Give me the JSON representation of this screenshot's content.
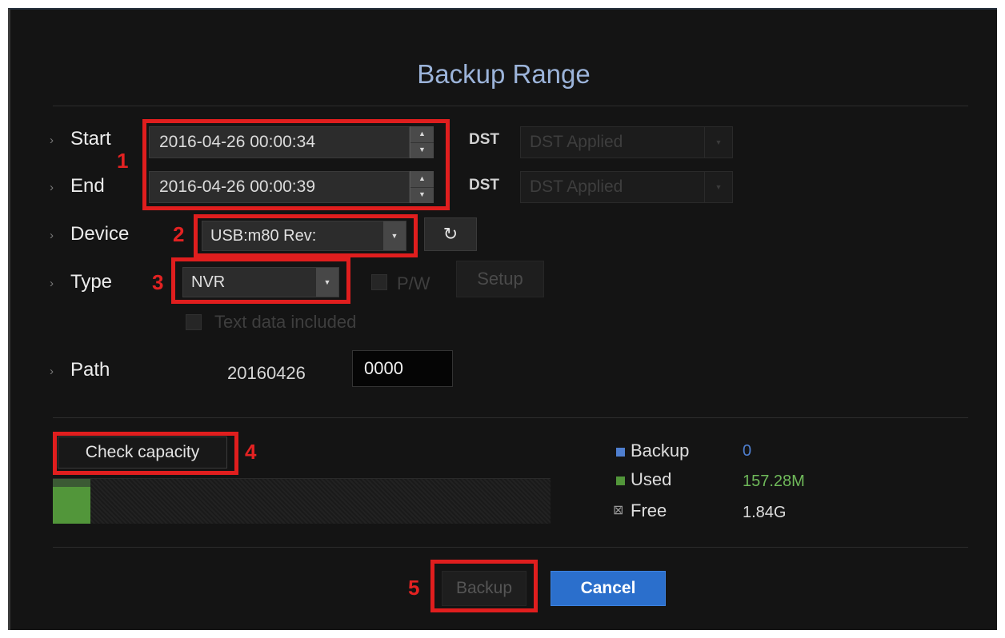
{
  "title": "Backup Range",
  "start": {
    "label": "Start",
    "value": "2016-04-26  00:00:34",
    "dst_label": "DST",
    "dst_value": "DST Applied"
  },
  "end": {
    "label": "End",
    "value": "2016-04-26  00:00:39",
    "dst_label": "DST",
    "dst_value": "DST Applied"
  },
  "device": {
    "label": "Device",
    "value": "USB:m80 Rev:"
  },
  "type": {
    "label": "Type",
    "value": "NVR",
    "pw_label": "P/W",
    "setup_label": "Setup",
    "text_data_label": "Text data included"
  },
  "path": {
    "label": "Path",
    "prefix": "20160426",
    "value": "0000"
  },
  "capacity": {
    "button_label": "Check capacity",
    "used_fraction": 0.075,
    "legend": [
      {
        "name": "Backup",
        "value": "0",
        "color": "#4f7fd0",
        "value_color": "#4f7fd0"
      },
      {
        "name": "Used",
        "value": "157.28M",
        "color": "#52963a",
        "value_color": "#6fb95a"
      },
      {
        "name": "Free",
        "value": "1.84G",
        "color": "#666666",
        "value_color": "#dedede"
      }
    ]
  },
  "buttons": {
    "backup_label": "Backup",
    "cancel_label": "Cancel"
  },
  "annotations": {
    "n1": "1",
    "n2": "2",
    "n3": "3",
    "n4": "4",
    "n5": "5"
  },
  "icons": {
    "bullet": "›",
    "spin_up": "▲",
    "spin_down": "▼",
    "dropdown": "▼",
    "refresh": "↻",
    "free_legend": "⊠"
  }
}
